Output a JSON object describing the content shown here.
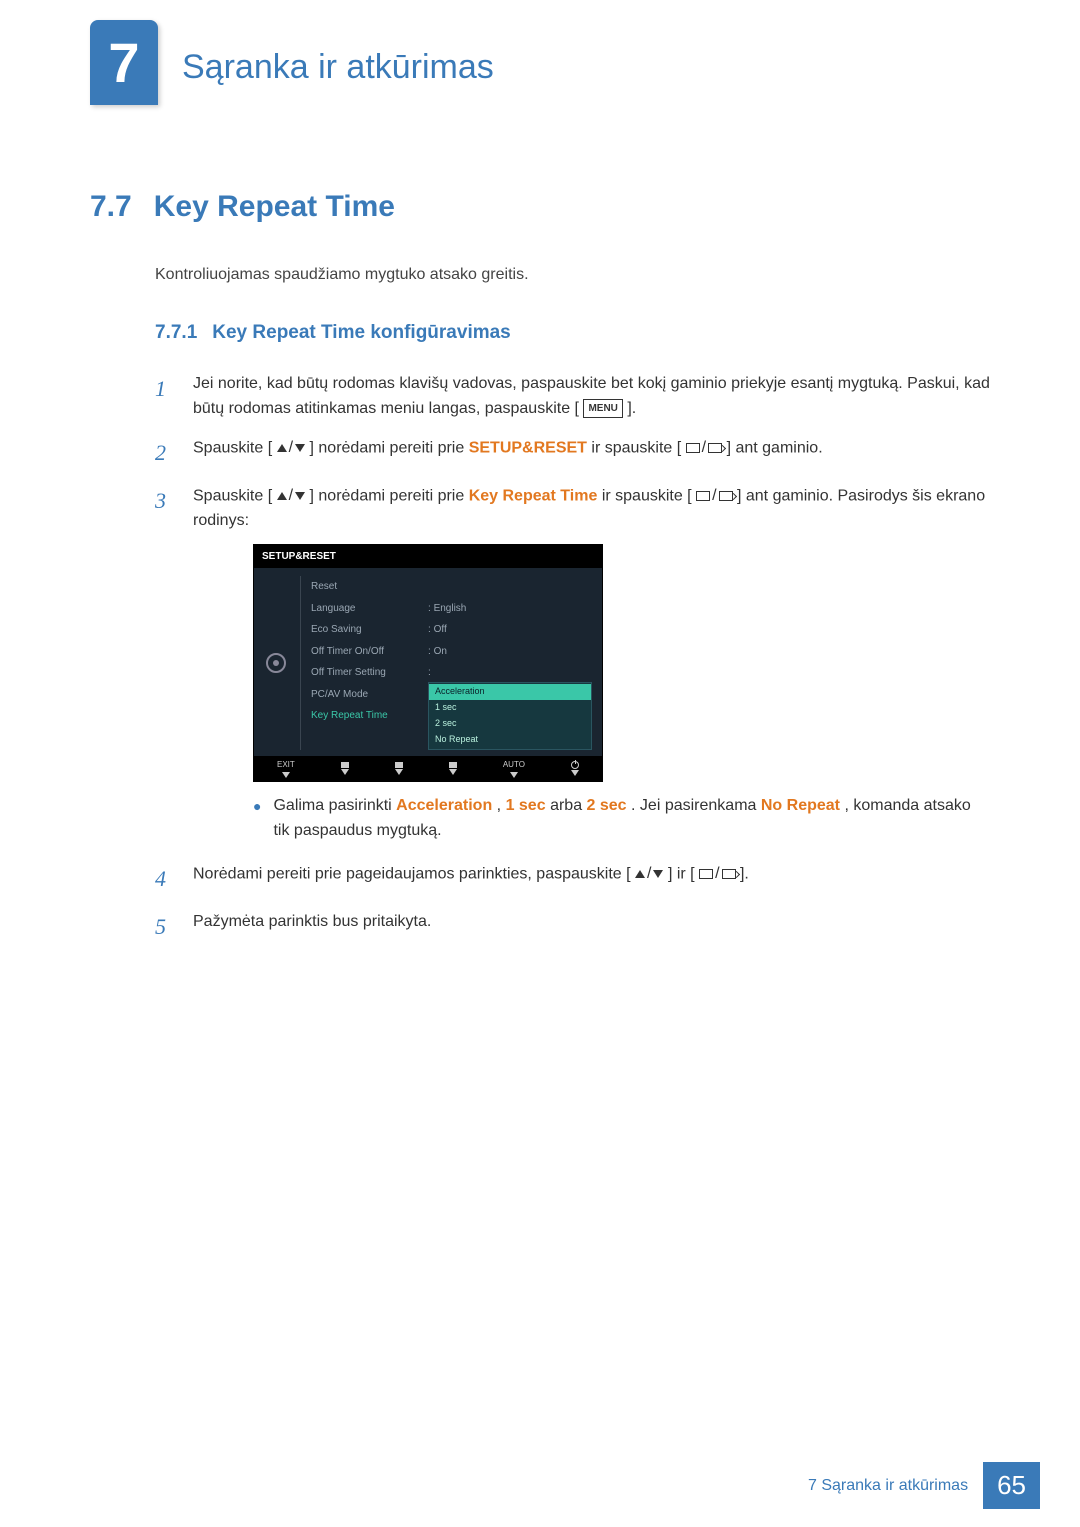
{
  "chapter": {
    "number": "7",
    "title": "Sąranka ir atkūrimas"
  },
  "section": {
    "number": "7.7",
    "title": "Key Repeat Time"
  },
  "intro": "Kontroliuojamas spaudžiamo mygtuko atsako greitis.",
  "subsection": {
    "number": "7.7.1",
    "title": "Key Repeat Time konfigūravimas"
  },
  "steps": {
    "s1a": "Jei norite, kad būtų rodomas klavišų vadovas, paspauskite bet kokį gaminio priekyje esantį mygtuką. Paskui, kad būtų rodomas atitinkamas meniu langas, paspauskite [",
    "s1b": "].",
    "s2a": "Spauskite [",
    "s2b": "] norėdami pereiti prie ",
    "s2c": "SETUP&RESET",
    "s2d": " ir spauskite [",
    "s2e": "] ant gaminio.",
    "s3a": "Spauskite [",
    "s3b": "] norėdami pereiti prie ",
    "s3c": "Key Repeat Time",
    "s3d": " ir spauskite [",
    "s3e": "] ant gaminio. Pasirodys šis ekrano rodinys:",
    "bullet_a": "Galima pasirinkti ",
    "bullet_b": "Acceleration",
    "bullet_c": ", ",
    "bullet_d": "1 sec",
    "bullet_e": " arba ",
    "bullet_f": "2 sec",
    "bullet_g": ". Jei pasirenkama ",
    "bullet_h": "No Repeat",
    "bullet_i": ", komanda atsako tik paspaudus mygtuką.",
    "s4a": "Norėdami pereiti prie pageidaujamos parinkties, paspauskite [",
    "s4b": "] ir [",
    "s4c": "].",
    "s5": "Pažymėta parinktis bus pritaikyta."
  },
  "menu_label": "MENU",
  "osd": {
    "title": "SETUP&RESET",
    "rows": [
      {
        "label": "Reset",
        "value": ""
      },
      {
        "label": "Language",
        "value": "English"
      },
      {
        "label": "Eco Saving",
        "value": "Off"
      },
      {
        "label": "Off Timer On/Off",
        "value": "On"
      },
      {
        "label": "Off Timer Setting",
        "value": ""
      },
      {
        "label": "PC/AV Mode",
        "value": ""
      },
      {
        "label": "Key Repeat Time",
        "value": ""
      }
    ],
    "options": [
      "Acceleration",
      "1 sec",
      "2 sec",
      "No Repeat"
    ],
    "footer": {
      "exit": "EXIT",
      "auto": "AUTO"
    }
  },
  "footer": {
    "text": "7 Sąranka ir atkūrimas",
    "page": "65"
  }
}
